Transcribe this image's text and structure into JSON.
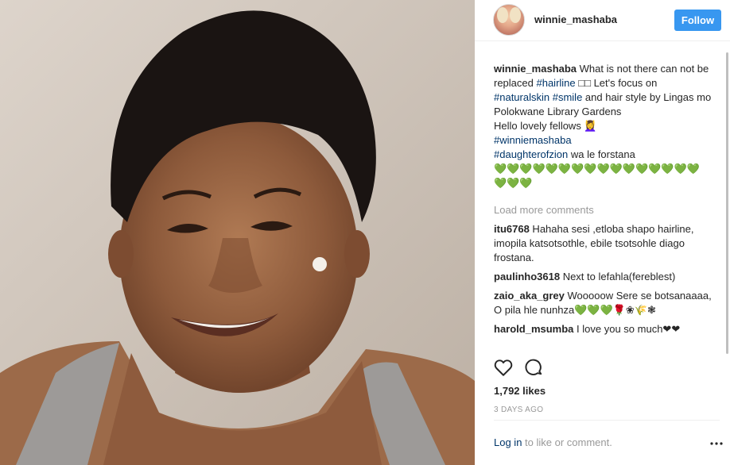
{
  "post": {
    "username": "winnie_mashaba",
    "follow_label": "Follow",
    "caption": {
      "username": "winnie_mashaba",
      "t1": " What is not there can not be replaced ",
      "tag1": "#hairline",
      "t2": " □□ Let's focus on ",
      "tag2": "#naturalskin",
      "t3": " ",
      "tag3": "#smile",
      "t4": " and hair style by Lingas mo Polokwane Library Gardens",
      "t5": "Hello lovely fellows 💆‍♀️",
      "tag4": "#winniemashaba",
      "tag5": "#daughterofzion",
      "t6": " wa le forstana",
      "hearts": "💚💚💚💚💚💚💚💚💚💚💚💚💚💚💚💚💚💚💚"
    },
    "load_more": "Load more comments",
    "comments": [
      {
        "user": "itu6768",
        "text": " Hahaha sesi ,etloba shapo hairline, imopila katsotsothle, ebile tsotsohle diago frostana."
      },
      {
        "user": "paulinho3618",
        "text": " Next to lefahla(fereblest)"
      },
      {
        "user": "zaio_aka_grey",
        "text": " Wooooow Sere se botsanaaaa, O pila hle nunhza💚💚💚🌹❀🌾❃"
      },
      {
        "user": "harold_msumba",
        "text": " I love you so much❤❤"
      }
    ],
    "likes": "1,792 likes",
    "date": "3 DAYS AGO",
    "login_link": "Log in",
    "login_rest": " to like or comment.",
    "more_icon": "•••"
  },
  "icons": {
    "like": "heart-icon",
    "comment": "comment-icon",
    "more": "more-options-icon"
  },
  "colors": {
    "accent": "#3897f0",
    "link": "#003569",
    "muted": "#999999"
  }
}
